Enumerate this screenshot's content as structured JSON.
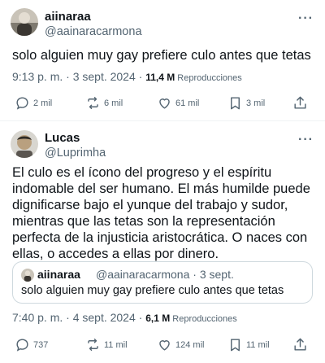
{
  "tweet1": {
    "display_name": "aiinaraa",
    "handle": "@aainaracarmona",
    "more": "···",
    "text": "solo alguien muy gay prefiere culo antes que tetas",
    "time_date": "9:13 p. m. · 3 sept. 2024 · ",
    "views_count": "11,4 M",
    "views_label": " Reproducciones",
    "replies": "2 mil",
    "retweets": "6 mil",
    "likes": "61 mil",
    "bookmarks": "3 mil"
  },
  "tweet2": {
    "display_name": "Lucas",
    "handle": "@Luprimha",
    "more": "···",
    "text_lines": [
      "El culo es el ícono del progreso y el espíritu",
      "indomable del ser humano. El más humilde puede",
      "dignificarse bajo el yunque del trabajo y sudor,",
      "mientras que las tetas son la representación",
      "perfecta de la injusticia aristocrática. O naces con",
      "ellas, o accedes a ellas por dinero."
    ],
    "quote": {
      "display_name": "aiinaraa",
      "handle_date": "@aainaracarmona · 3 sept.",
      "text": "solo alguien muy gay prefiere culo antes que tetas"
    },
    "time_date": "7:40 p. m. · 4 sept. 2024 · ",
    "views_count": "6,1 M",
    "views_label": " Reproducciones",
    "replies": "737",
    "retweets": "11 mil",
    "likes": "124 mil",
    "bookmarks": "11 mil"
  },
  "icons": {
    "reply": "reply-icon",
    "retweet": "retweet-icon",
    "like": "heart-icon",
    "bookmark": "bookmark-icon",
    "share": "share-icon"
  },
  "colors": {
    "text": "#0f1419",
    "secondary": "#536471",
    "border": "#cfd9de"
  }
}
